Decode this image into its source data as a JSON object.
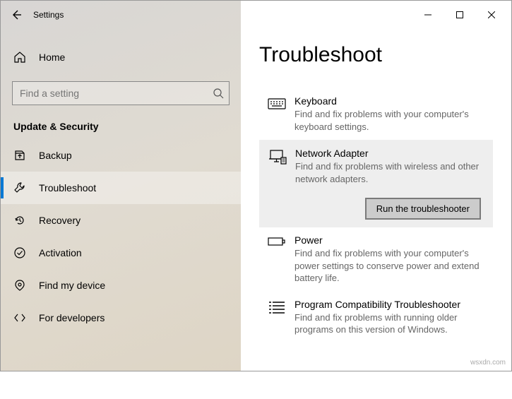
{
  "window": {
    "title": "Settings"
  },
  "home": {
    "label": "Home"
  },
  "search": {
    "placeholder": "Find a setting"
  },
  "section": {
    "header": "Update & Security"
  },
  "nav": {
    "items": [
      {
        "label": "Backup"
      },
      {
        "label": "Troubleshoot"
      },
      {
        "label": "Recovery"
      },
      {
        "label": "Activation"
      },
      {
        "label": "Find my device"
      },
      {
        "label": "For developers"
      }
    ]
  },
  "page": {
    "title": "Troubleshoot",
    "run_button": "Run the troubleshooter",
    "items": [
      {
        "title": "Keyboard",
        "desc": "Find and fix problems with your computer's keyboard settings."
      },
      {
        "title": "Network Adapter",
        "desc": "Find and fix problems with wireless and other network adapters."
      },
      {
        "title": "Power",
        "desc": "Find and fix problems with your computer's power settings to conserve power and extend battery life."
      },
      {
        "title": "Program Compatibility Troubleshooter",
        "desc": "Find and fix problems with running older programs on this version of Windows."
      }
    ]
  },
  "watermark": "wsxdn.com"
}
